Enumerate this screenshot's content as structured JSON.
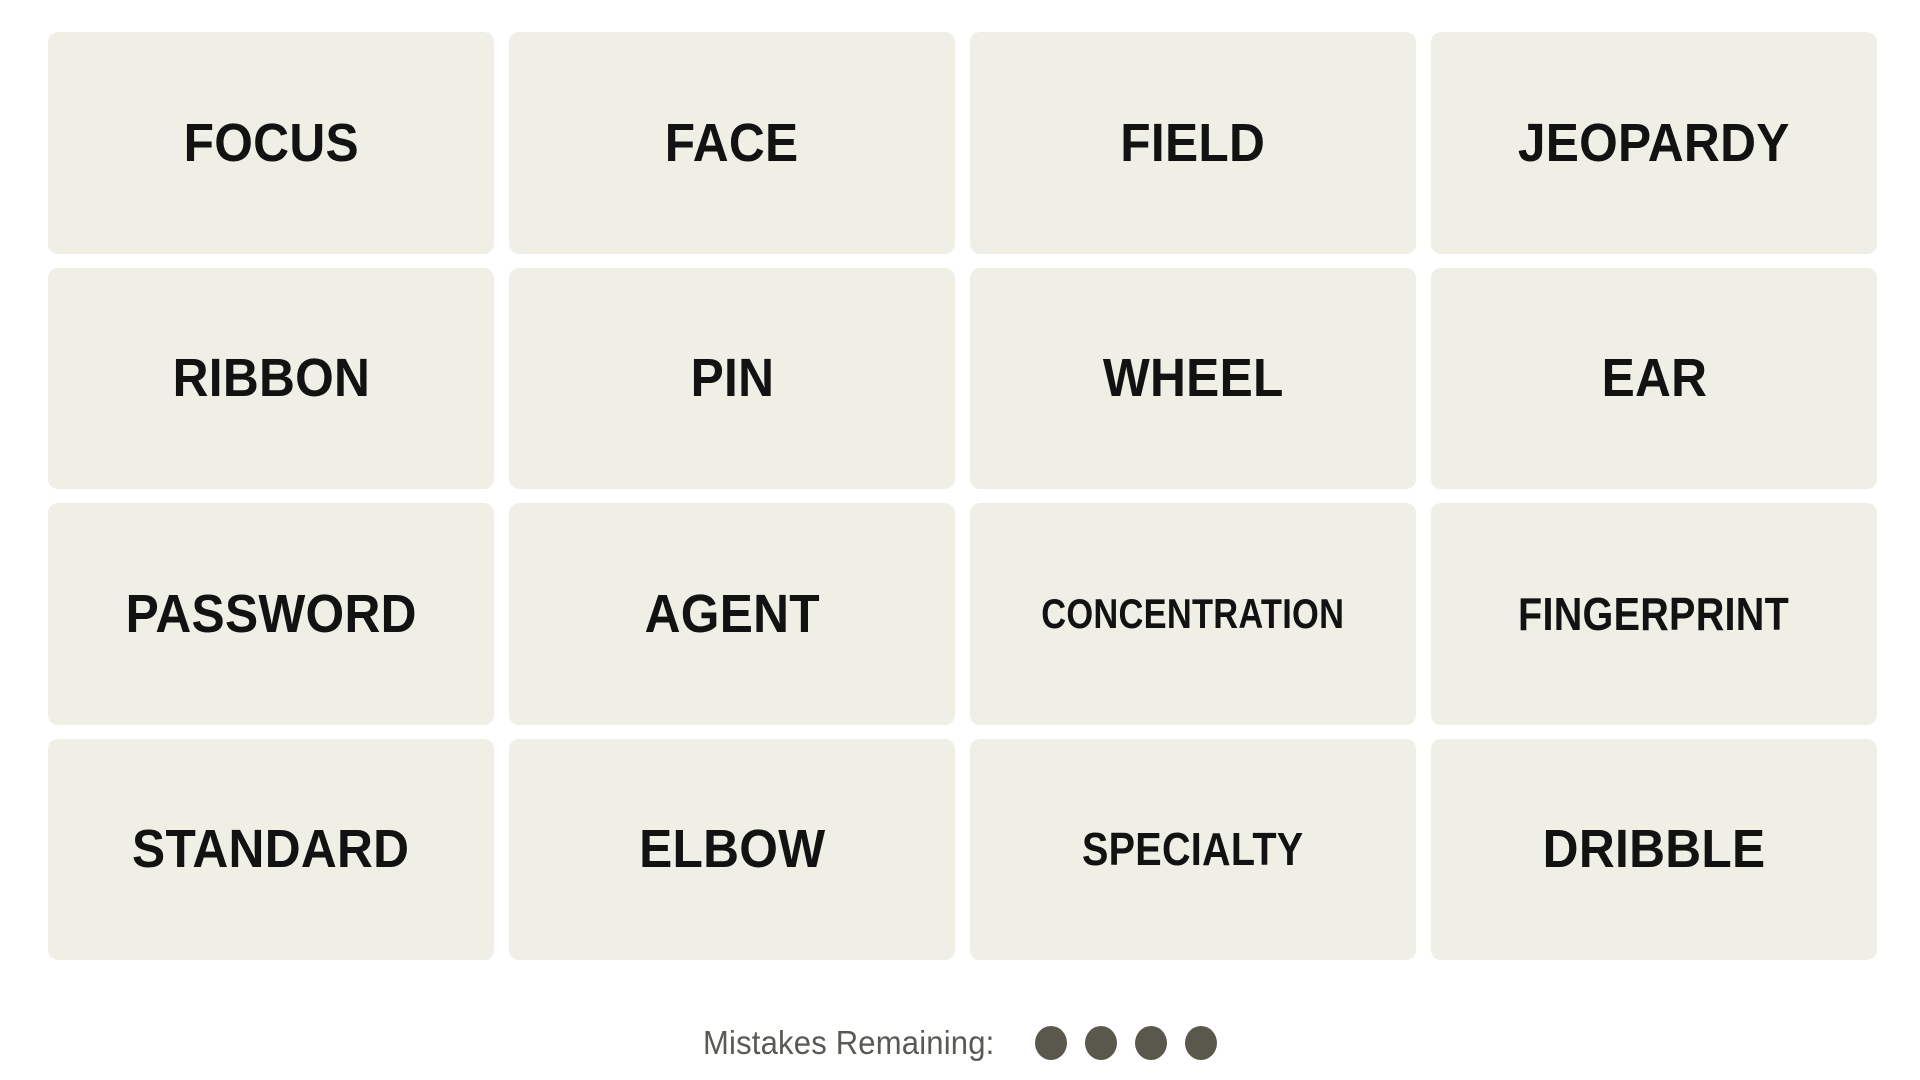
{
  "app": {
    "name": "Connections",
    "background_color": "#ffffff"
  },
  "theme": {
    "tile_background": "#efefe6",
    "tile_text_color": "#121212",
    "mistake_dot_color": "#5a584d",
    "mistake_label_color": "#5a5a55"
  },
  "grid": {
    "rows": 4,
    "columns": 4,
    "tiles": [
      {
        "label": "FOCUS",
        "row": 1,
        "col": 1,
        "selected": false
      },
      {
        "label": "FACE",
        "row": 1,
        "col": 2,
        "selected": false
      },
      {
        "label": "FIELD",
        "row": 1,
        "col": 3,
        "selected": false
      },
      {
        "label": "JEOPARDY",
        "row": 1,
        "col": 4,
        "selected": false
      },
      {
        "label": "RIBBON",
        "row": 2,
        "col": 1,
        "selected": false
      },
      {
        "label": "PIN",
        "row": 2,
        "col": 2,
        "selected": false
      },
      {
        "label": "WHEEL",
        "row": 2,
        "col": 3,
        "selected": false
      },
      {
        "label": "EAR",
        "row": 2,
        "col": 4,
        "selected": false
      },
      {
        "label": "PASSWORD",
        "row": 3,
        "col": 1,
        "selected": false
      },
      {
        "label": "AGENT",
        "row": 3,
        "col": 2,
        "selected": false
      },
      {
        "label": "CONCENTRATION",
        "row": 3,
        "col": 3,
        "selected": false
      },
      {
        "label": "FINGERPRINT",
        "row": 3,
        "col": 4,
        "selected": false
      },
      {
        "label": "STANDARD",
        "row": 4,
        "col": 1,
        "selected": false
      },
      {
        "label": "ELBOW",
        "row": 4,
        "col": 2,
        "selected": false
      },
      {
        "label": "SPECIALTY",
        "row": 4,
        "col": 3,
        "selected": false
      },
      {
        "label": "DRIBBLE",
        "row": 4,
        "col": 4,
        "selected": false
      }
    ]
  },
  "footer": {
    "mistakes_label": "Mistakes Remaining:",
    "mistakes_remaining": 4,
    "dots": [
      {
        "name": "mistake-dot-1",
        "filled": true
      },
      {
        "name": "mistake-dot-2",
        "filled": true
      },
      {
        "name": "mistake-dot-3",
        "filled": true
      },
      {
        "name": "mistake-dot-4",
        "filled": true
      }
    ]
  }
}
